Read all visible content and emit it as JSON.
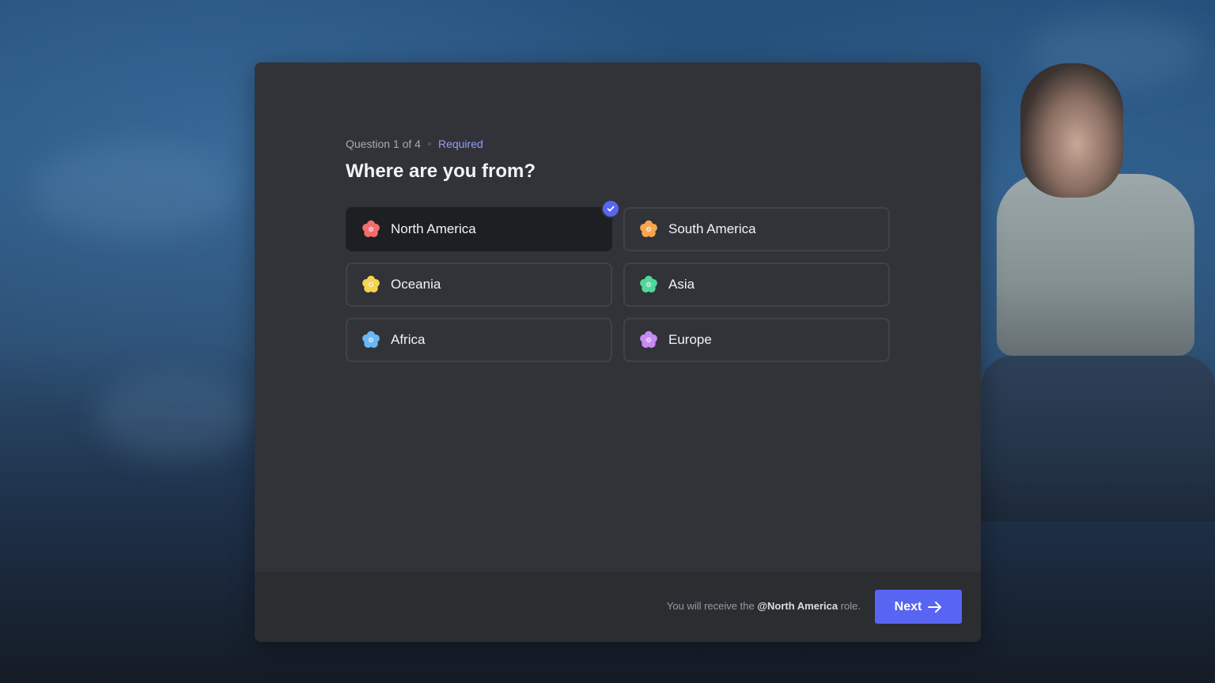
{
  "question": {
    "progress": "Question 1 of 4",
    "required_label": "Required",
    "title": "Where are you from?"
  },
  "options": [
    {
      "label": "North America",
      "icon": "flower-icon",
      "color": "#f46d6d",
      "selected": true
    },
    {
      "label": "South America",
      "icon": "flower-icon",
      "color": "#f7a64f",
      "selected": false
    },
    {
      "label": "Oceania",
      "icon": "flower-icon",
      "color": "#f4d452",
      "selected": false
    },
    {
      "label": "Asia",
      "icon": "flower-icon",
      "color": "#4fd89a",
      "selected": false
    },
    {
      "label": "Africa",
      "icon": "flower-icon",
      "color": "#6ab6f4",
      "selected": false
    },
    {
      "label": "Europe",
      "icon": "flower-icon",
      "color": "#c78af2",
      "selected": false
    }
  ],
  "footer": {
    "role_prefix": "You will receive the ",
    "role_name": "@North America",
    "role_suffix": " role.",
    "next_label": "Next"
  },
  "colors": {
    "accent": "#5865f2",
    "required": "#949cf7",
    "modal_bg": "#313338",
    "footer_bg": "#2b2d31"
  }
}
